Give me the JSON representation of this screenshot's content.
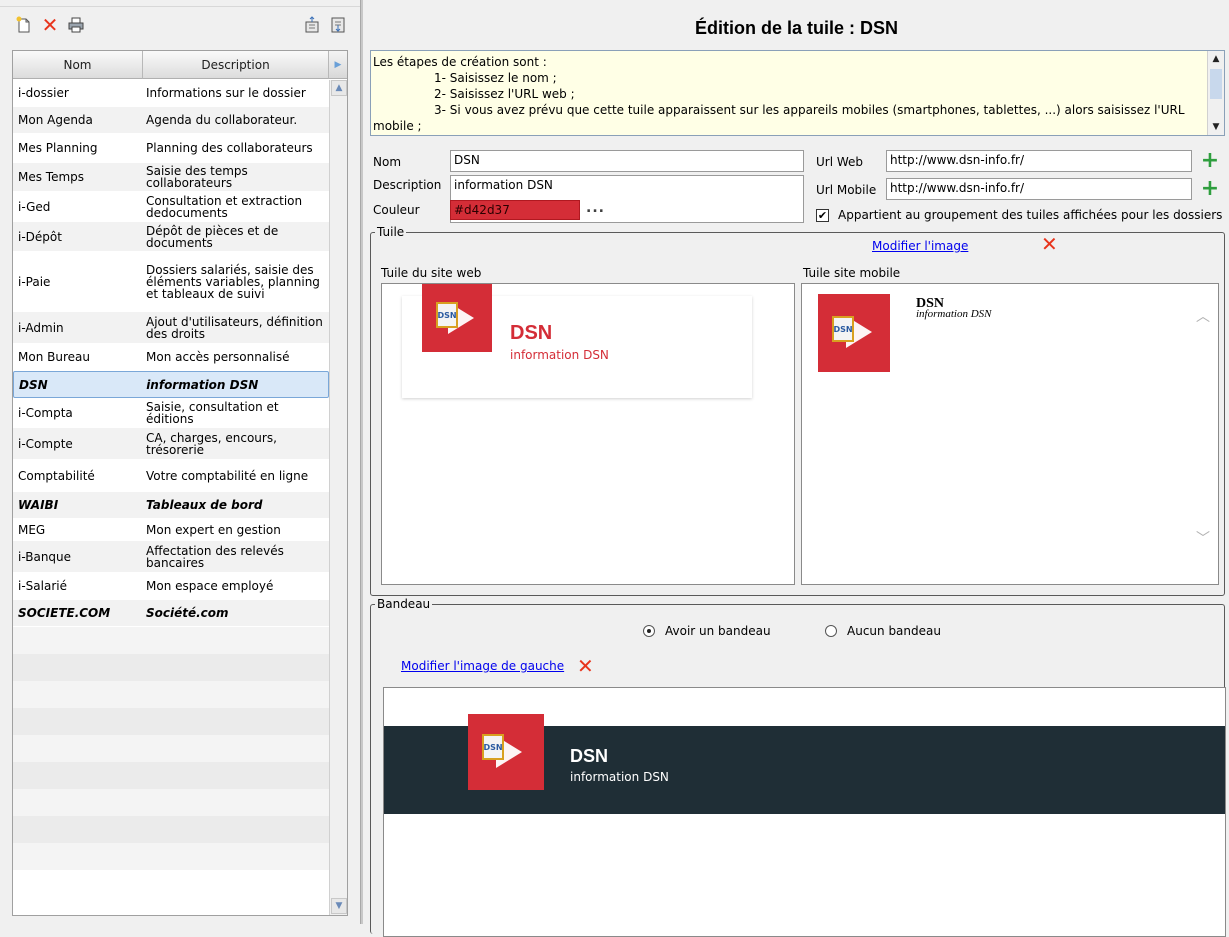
{
  "left": {
    "toolbar": {
      "new_icon": "new-document-icon",
      "delete_icon": "delete-icon",
      "print_icon": "print-icon",
      "import_icon": "import-icon",
      "export_icon": "export-icon"
    },
    "columns": [
      "Nom",
      "Description"
    ],
    "rows": [
      {
        "nom": "i-dossier",
        "desc": "Informations sur le dossier",
        "h": 27,
        "bold": false
      },
      {
        "nom": "Mon Agenda",
        "desc": "Agenda du collaborateur.",
        "h": 27,
        "bold": false
      },
      {
        "nom": "Mes Planning",
        "desc": "Planning des collaborateurs",
        "h": 29,
        "bold": false
      },
      {
        "nom": "Mes Temps",
        "desc": "Saisie des temps collaborateurs",
        "h": 29,
        "bold": false
      },
      {
        "nom": "i-Ged",
        "desc": "Consultation et extraction dedocuments",
        "h": 30,
        "bold": false
      },
      {
        "nom": "i-Dépôt",
        "desc": "Dépôt de pièces et de documents",
        "h": 30,
        "bold": false
      },
      {
        "nom": "i-Paie",
        "desc": "Dossiers salariés, saisie des éléments variables, planning et tableaux de suivi",
        "h": 60,
        "bold": false
      },
      {
        "nom": "i-Admin",
        "desc": "Ajout d'utilisateurs, définition des droits",
        "h": 32,
        "bold": false
      },
      {
        "nom": "Mon Bureau",
        "desc": "Mon accès personnalisé",
        "h": 27,
        "bold": false
      },
      {
        "nom": "DSN",
        "desc": "information DSN",
        "h": 27,
        "bold": true,
        "selected": true
      },
      {
        "nom": "i-Compta",
        "desc": "Saisie, consultation et éditions",
        "h": 30,
        "bold": false
      },
      {
        "nom": "i-Compte",
        "desc": "CA, charges, encours, trésorerie",
        "h": 32,
        "bold": false
      },
      {
        "nom": "Comptabilité",
        "desc": "Votre comptabilité en ligne",
        "h": 32,
        "bold": false
      },
      {
        "nom": "WAIBI",
        "desc": "Tableaux de bord",
        "h": 27,
        "bold": true
      },
      {
        "nom": "MEG",
        "desc": "Mon expert en gestion",
        "h": 22,
        "bold": false
      },
      {
        "nom": "i-Banque",
        "desc": "Affectation des relevés bancaires",
        "h": 32,
        "bold": false
      },
      {
        "nom": "i-Salarié",
        "desc": "Mon espace employé",
        "h": 27,
        "bold": false
      },
      {
        "nom": "SOCIETE.COM",
        "desc": "Société.com",
        "h": 27,
        "bold": true
      }
    ],
    "filler_rows": 9
  },
  "right": {
    "title": "Édition de la tuile : DSN",
    "instructions": "Les étapes de création sont :\n\t\t1- Saisissez le nom ;\n\t\t2- Saisissez l'URL web ;\n\t\t3- Si vous avez prévu que cette tuile apparaissent sur les appareils mobiles (smartphones, tablettes, ...) alors saisissez l'URL mobile ;",
    "form": {
      "nom_label": "Nom",
      "nom_value": "DSN",
      "description_label": "Description",
      "description_value": "information DSN",
      "couleur_label": "Couleur",
      "couleur_value": "#d42d37",
      "couleur_dots": "...",
      "url_web_label": "Url Web",
      "url_web_value": "http://www.dsn-info.fr/",
      "url_mobile_label": "Url Mobile",
      "url_mobile_value": "http://www.dsn-info.fr/",
      "groupement_checked": true,
      "groupement_label": "Appartient au groupement des tuiles affichées pour les dossiers"
    },
    "tuile": {
      "group_title": "Tuile",
      "modify_image_link": "Modifier l'image",
      "web_panel_label": "Tuile du site web",
      "mobile_panel_label": "Tuile site mobile",
      "tile_title": "DSN",
      "tile_desc": "information DSN",
      "tile_color": "#d42d37"
    },
    "bandeau": {
      "group_title": "Bandeau",
      "option_with": "Avoir un bandeau",
      "option_without": "Aucun bandeau",
      "selected": "with",
      "modify_left_image_link": "Modifier l'image de gauche",
      "banner_title": "DSN",
      "banner_desc": "information DSN",
      "banner_bg": "#1f2e36"
    }
  }
}
